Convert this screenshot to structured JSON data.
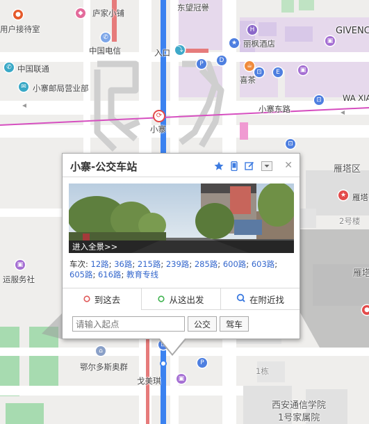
{
  "map": {
    "labels": {
      "user_reception": "用户接待室",
      "lujia_shop": "庐家小铺",
      "dongwang_coffee": "东望冠譽",
      "china_telecom": "中国电信",
      "lifeng_hotel": "丽枫酒店",
      "givenchy": "GIVENCH",
      "china_unicom": "中国联通",
      "entrance": "入口",
      "xicha": "喜茶",
      "xiaozhai_post": "小寨邮局营业部",
      "xiaozhai_east_road": "小寨东路",
      "wa_xiang": "WA XIAN",
      "xiaozhai_station": "小寨",
      "yanta_district": "雁塔区",
      "yanta_right": "雁塔",
      "building2": "2号楼",
      "yanta_mid": "雁塔",
      "transport_service": "运服务社",
      "ordos_apt": "鄂尔多斯奥群",
      "gemeiqi": "戈美琪",
      "building1": "1栋",
      "xian_telecom_college": "西安通信学院",
      "family_yard": "1号家属院"
    }
  },
  "popup": {
    "title": "小寨-公交车站",
    "panorama_label": "进入全景>>",
    "routes_label": "车次:",
    "routes": [
      "12路",
      "36路",
      "215路",
      "239路",
      "285路",
      "600路",
      "603路",
      "605路",
      "616路",
      "教育专线"
    ],
    "tabs": [
      "到这去",
      "从这出发",
      "在附近找"
    ],
    "input_placeholder": "请输入起点",
    "bus_button": "公交",
    "drive_button": "驾车"
  }
}
